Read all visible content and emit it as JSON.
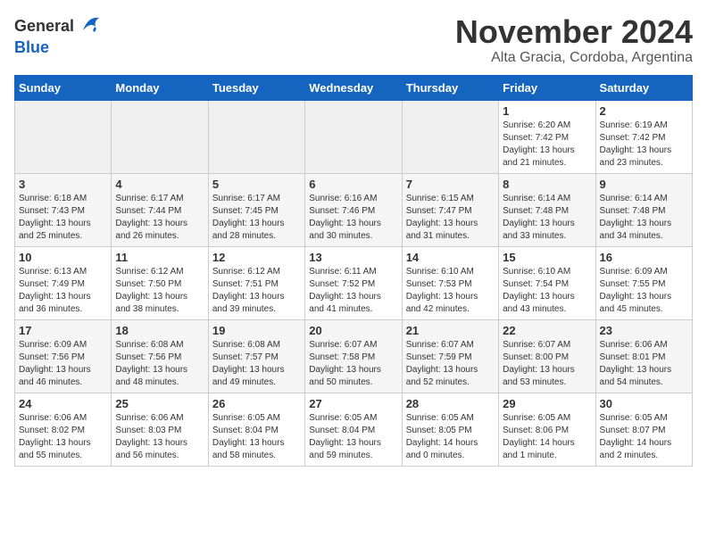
{
  "header": {
    "logo_general": "General",
    "logo_blue": "Blue",
    "month_title": "November 2024",
    "subtitle": "Alta Gracia, Cordoba, Argentina"
  },
  "weekdays": [
    "Sunday",
    "Monday",
    "Tuesday",
    "Wednesday",
    "Thursday",
    "Friday",
    "Saturday"
  ],
  "weeks": [
    [
      {
        "day": "",
        "info": ""
      },
      {
        "day": "",
        "info": ""
      },
      {
        "day": "",
        "info": ""
      },
      {
        "day": "",
        "info": ""
      },
      {
        "day": "",
        "info": ""
      },
      {
        "day": "1",
        "info": "Sunrise: 6:20 AM\nSunset: 7:42 PM\nDaylight: 13 hours\nand 21 minutes."
      },
      {
        "day": "2",
        "info": "Sunrise: 6:19 AM\nSunset: 7:42 PM\nDaylight: 13 hours\nand 23 minutes."
      }
    ],
    [
      {
        "day": "3",
        "info": "Sunrise: 6:18 AM\nSunset: 7:43 PM\nDaylight: 13 hours\nand 25 minutes."
      },
      {
        "day": "4",
        "info": "Sunrise: 6:17 AM\nSunset: 7:44 PM\nDaylight: 13 hours\nand 26 minutes."
      },
      {
        "day": "5",
        "info": "Sunrise: 6:17 AM\nSunset: 7:45 PM\nDaylight: 13 hours\nand 28 minutes."
      },
      {
        "day": "6",
        "info": "Sunrise: 6:16 AM\nSunset: 7:46 PM\nDaylight: 13 hours\nand 30 minutes."
      },
      {
        "day": "7",
        "info": "Sunrise: 6:15 AM\nSunset: 7:47 PM\nDaylight: 13 hours\nand 31 minutes."
      },
      {
        "day": "8",
        "info": "Sunrise: 6:14 AM\nSunset: 7:48 PM\nDaylight: 13 hours\nand 33 minutes."
      },
      {
        "day": "9",
        "info": "Sunrise: 6:14 AM\nSunset: 7:48 PM\nDaylight: 13 hours\nand 34 minutes."
      }
    ],
    [
      {
        "day": "10",
        "info": "Sunrise: 6:13 AM\nSunset: 7:49 PM\nDaylight: 13 hours\nand 36 minutes."
      },
      {
        "day": "11",
        "info": "Sunrise: 6:12 AM\nSunset: 7:50 PM\nDaylight: 13 hours\nand 38 minutes."
      },
      {
        "day": "12",
        "info": "Sunrise: 6:12 AM\nSunset: 7:51 PM\nDaylight: 13 hours\nand 39 minutes."
      },
      {
        "day": "13",
        "info": "Sunrise: 6:11 AM\nSunset: 7:52 PM\nDaylight: 13 hours\nand 41 minutes."
      },
      {
        "day": "14",
        "info": "Sunrise: 6:10 AM\nSunset: 7:53 PM\nDaylight: 13 hours\nand 42 minutes."
      },
      {
        "day": "15",
        "info": "Sunrise: 6:10 AM\nSunset: 7:54 PM\nDaylight: 13 hours\nand 43 minutes."
      },
      {
        "day": "16",
        "info": "Sunrise: 6:09 AM\nSunset: 7:55 PM\nDaylight: 13 hours\nand 45 minutes."
      }
    ],
    [
      {
        "day": "17",
        "info": "Sunrise: 6:09 AM\nSunset: 7:56 PM\nDaylight: 13 hours\nand 46 minutes."
      },
      {
        "day": "18",
        "info": "Sunrise: 6:08 AM\nSunset: 7:56 PM\nDaylight: 13 hours\nand 48 minutes."
      },
      {
        "day": "19",
        "info": "Sunrise: 6:08 AM\nSunset: 7:57 PM\nDaylight: 13 hours\nand 49 minutes."
      },
      {
        "day": "20",
        "info": "Sunrise: 6:07 AM\nSunset: 7:58 PM\nDaylight: 13 hours\nand 50 minutes."
      },
      {
        "day": "21",
        "info": "Sunrise: 6:07 AM\nSunset: 7:59 PM\nDaylight: 13 hours\nand 52 minutes."
      },
      {
        "day": "22",
        "info": "Sunrise: 6:07 AM\nSunset: 8:00 PM\nDaylight: 13 hours\nand 53 minutes."
      },
      {
        "day": "23",
        "info": "Sunrise: 6:06 AM\nSunset: 8:01 PM\nDaylight: 13 hours\nand 54 minutes."
      }
    ],
    [
      {
        "day": "24",
        "info": "Sunrise: 6:06 AM\nSunset: 8:02 PM\nDaylight: 13 hours\nand 55 minutes."
      },
      {
        "day": "25",
        "info": "Sunrise: 6:06 AM\nSunset: 8:03 PM\nDaylight: 13 hours\nand 56 minutes."
      },
      {
        "day": "26",
        "info": "Sunrise: 6:05 AM\nSunset: 8:04 PM\nDaylight: 13 hours\nand 58 minutes."
      },
      {
        "day": "27",
        "info": "Sunrise: 6:05 AM\nSunset: 8:04 PM\nDaylight: 13 hours\nand 59 minutes."
      },
      {
        "day": "28",
        "info": "Sunrise: 6:05 AM\nSunset: 8:05 PM\nDaylight: 14 hours\nand 0 minutes."
      },
      {
        "day": "29",
        "info": "Sunrise: 6:05 AM\nSunset: 8:06 PM\nDaylight: 14 hours\nand 1 minute."
      },
      {
        "day": "30",
        "info": "Sunrise: 6:05 AM\nSunset: 8:07 PM\nDaylight: 14 hours\nand 2 minutes."
      }
    ]
  ]
}
